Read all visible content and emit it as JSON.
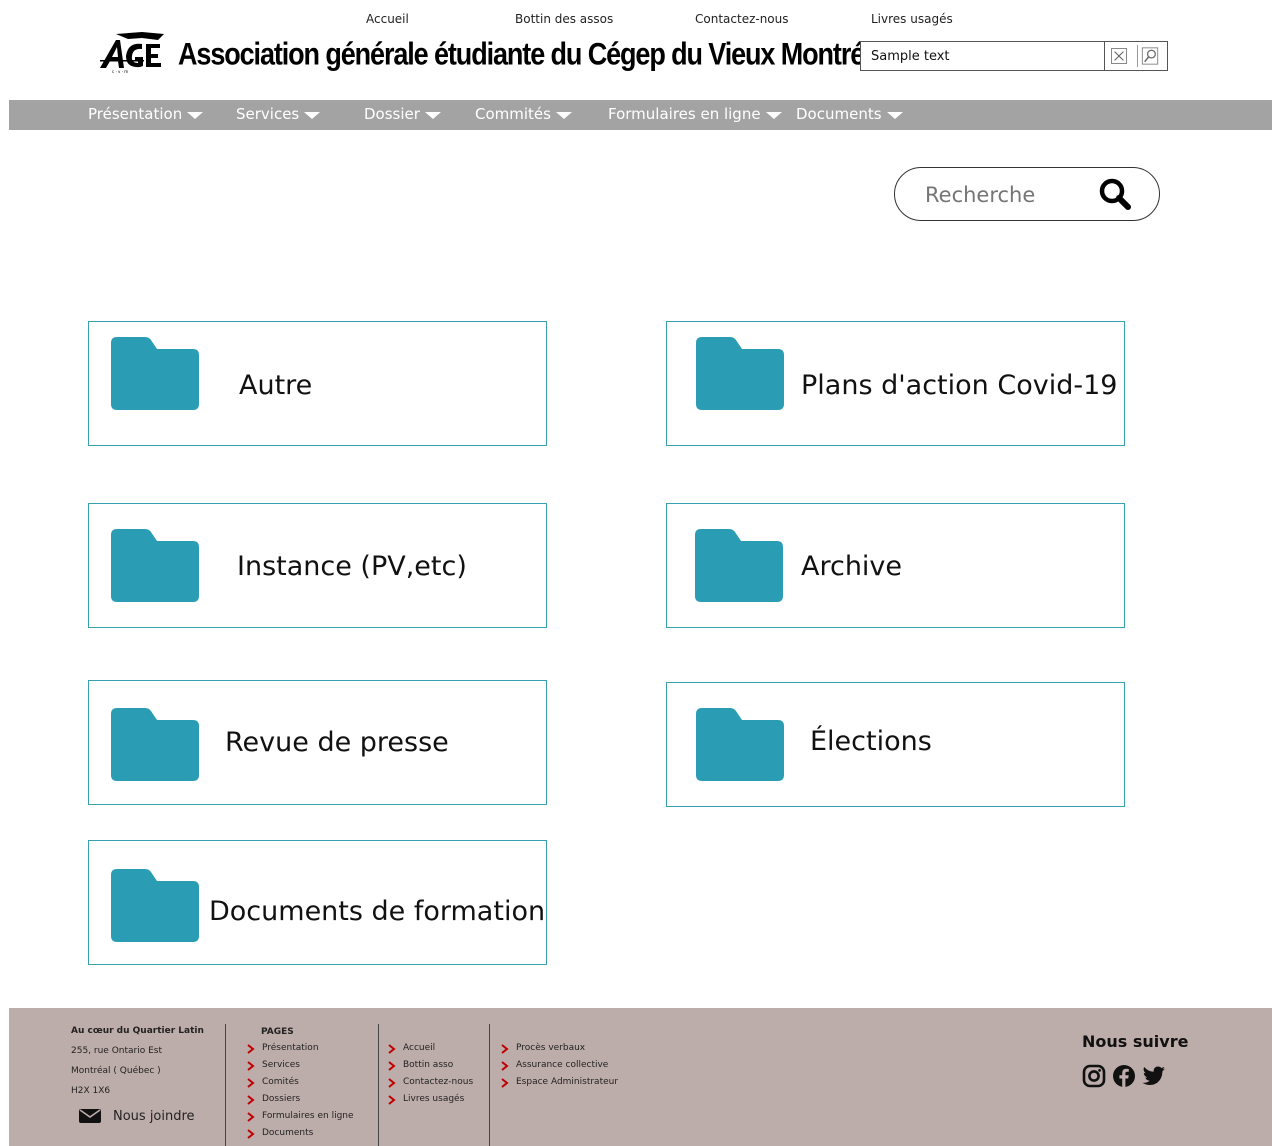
{
  "top_links": [
    "Accueil",
    "Bottin des assos",
    "Contactez-nous",
    "Livres usagés"
  ],
  "header": {
    "logo_text": "AGE",
    "title": "Association générale étudiante du Cégep du Vieux Montréal",
    "search_value": "Sample text"
  },
  "nav": [
    "Présentation",
    "Services",
    "Dossier",
    "Commités",
    "Formulaires en ligne",
    "Documents"
  ],
  "search": {
    "placeholder": "Recherche"
  },
  "folders": [
    "Autre",
    "Plans d'action Covid-19",
    "Instance (PV,etc)",
    "Archive",
    "Revue de presse",
    "Élections",
    "Documents de formation"
  ],
  "footer": {
    "heading": "Au cœur du Quartier Latin",
    "address": [
      "255, rue Ontario Est",
      "Montréal ( Québec )",
      "H2X 1X6"
    ],
    "contact_label": "Nous joindre",
    "pages_heading": "PAGES",
    "col1": [
      "Présentation",
      "Services",
      "Comités",
      "Dossiers",
      "Formulaires en ligne",
      "Documents"
    ],
    "col2": [
      "Accueil",
      "Bottin asso",
      "Contactez-nous",
      "Livres usagés"
    ],
    "col3": [
      "Procès verbaux",
      "Assurance collective",
      "Espace Administrateur"
    ],
    "follow_label": "Nous suivre",
    "social_icons": [
      "instagram-icon",
      "facebook-icon",
      "twitter-icon"
    ]
  },
  "colors": {
    "nav_bg": "#a3a3a3",
    "folder": "#2a9db5",
    "card_border": "#3a9fae",
    "footer_bg": "#bdadaa",
    "chevron": "#c00000"
  }
}
